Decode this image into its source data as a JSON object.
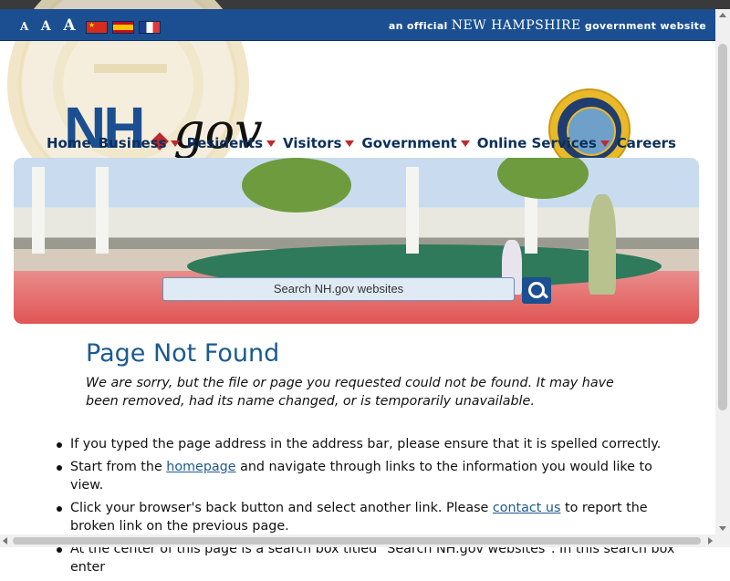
{
  "banner": {
    "font_sizes": [
      "A",
      "A",
      "A"
    ],
    "flags": [
      "chinese-flag-icon",
      "spanish-flag-icon",
      "french-flag-icon"
    ],
    "official_prefix": "an official",
    "official_state": "NEW HAMPSHIRE",
    "official_suffix": "government website"
  },
  "logo": {
    "nh": "NH",
    "gov": "gov"
  },
  "nav": {
    "items": [
      {
        "label": "Home",
        "has_menu": false
      },
      {
        "label": "Business",
        "has_menu": true
      },
      {
        "label": "Residents",
        "has_menu": true
      },
      {
        "label": "Visitors",
        "has_menu": true
      },
      {
        "label": "Government",
        "has_menu": true
      },
      {
        "label": "Online Services",
        "has_menu": true
      },
      {
        "label": "Careers",
        "has_menu": false
      }
    ]
  },
  "search": {
    "placeholder": "Search NH.gov websites",
    "button_icon": "search-icon"
  },
  "content": {
    "title": "Page Not Found",
    "message": "We are sorry, but the file or page you requested could not be found. It may have been removed, had its name changed, or is temporarily unavailable.",
    "suggestions": [
      {
        "text": "If you typed the page address in the address bar, please ensure that it is spelled correctly."
      },
      {
        "before": "Start from the ",
        "link": "homepage",
        "after": " and navigate through links to the information you would like to view."
      },
      {
        "before": "Click your browser's back button and select another link. Please ",
        "link": "contact us",
        "after": " to report the broken link on the previous page."
      },
      {
        "text": "At the center of this page is a search box titled \"Search NH.gov websites\". In this search box enter"
      }
    ]
  },
  "colors": {
    "primary": "#1b4f91",
    "accent": "#c0282d",
    "nav_text": "#0b2f5c"
  }
}
